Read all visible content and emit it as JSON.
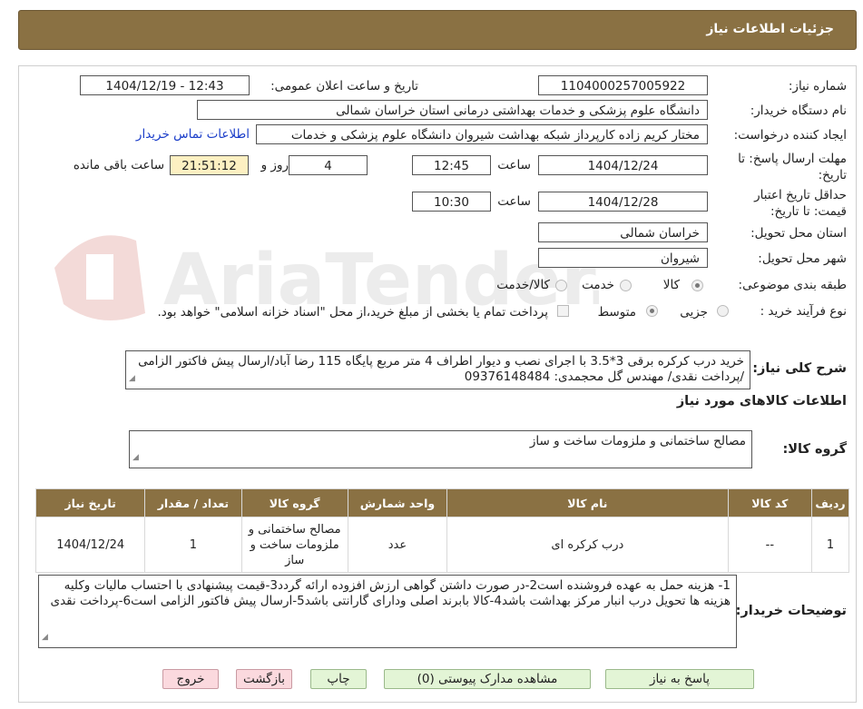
{
  "header": {
    "title": "جزئیات اطلاعات نیاز"
  },
  "watermark": {
    "text": "AriaTender.neT"
  },
  "form": {
    "need_number_label": "شماره نیاز:",
    "need_number": "1104000257005922",
    "announce_label": "تاریخ و ساعت اعلان عمومی:",
    "announce_value": "1404/12/19 - 12:43",
    "buyer_org_label": "نام دستگاه خریدار:",
    "buyer_org": "دانشگاه علوم پزشکی و خدمات بهداشتی درمانی استان خراسان شمالی",
    "creator_label": "ایجاد کننده درخواست:",
    "creator": "مختار کریم زاده کارپرداز شبکه بهداشت شیروان دانشگاه علوم پزشکی و خدمات",
    "contact_link": "اطلاعات تماس خریدار",
    "deadline_label": "مهلت ارسال پاسخ: تا تاریخ:",
    "deadline_date": "1404/12/24",
    "time_label": "ساعت",
    "deadline_time": "12:45",
    "days_value": "4",
    "days_label": "روز و",
    "remaining_time": "21:51:12",
    "remaining_label": "ساعت باقی مانده",
    "validity_label": "حداقل تاریخ اعتبار قیمت: تا تاریخ:",
    "validity_date": "1404/12/28",
    "validity_time": "10:30",
    "province_label": "استان محل تحویل:",
    "province": "خراسان شمالی",
    "city_label": "شهر محل تحویل:",
    "city": "شیروان",
    "category_label": "طبقه بندی موضوعی:",
    "category_options": [
      "کالا",
      "خدمت",
      "کالا/خدمت"
    ],
    "process_label": "نوع فرآیند خرید :",
    "process_options": [
      "جزیی",
      "متوسط"
    ],
    "payment_note": "پرداخت تمام یا بخشی از مبلغ خرید،از محل \"اسناد خزانه اسلامی\" خواهد بود."
  },
  "description": {
    "label": "شرح کلی نیاز:",
    "text": "خرید درب کرکره برقی 3*3.5 با اجرای نصب و دیوار اطراف 4 متر مربع پایگاه 115 رضا آباد/ارسال پیش فاکتور الزامی /پرداخت نقدی/ مهندس گل محجمدی: 09376148484"
  },
  "goods_section": {
    "title": "اطلاعات کالاهای مورد نیاز",
    "group_label": "گروه کالا:",
    "group_value": "مصالح ساختمانی و ملزومات ساخت و ساز"
  },
  "table": {
    "headers": [
      "ردیف",
      "کد کالا",
      "نام کالا",
      "واحد شمارش",
      "گروه کالا",
      "تعداد / مقدار",
      "تاریخ نیاز"
    ],
    "rows": [
      [
        "1",
        "--",
        "درب کرکره ای",
        "عدد",
        "مصالح ساختمانی و ملزومات ساخت و ساز",
        "1",
        "1404/12/24"
      ]
    ]
  },
  "buyer_notes": {
    "label": "توضیحات خریدار:",
    "text": "1- هزینه حمل به عهده فروشنده است2-در صورت داشتن گواهی ارزش افزوده ارائه گردد3-قیمت پیشنهادی با احتساب مالیات وکلیه هزینه ها تحویل درب انبار مرکز بهداشت  باشد4-کالا بابرند اصلی ودارای گارانتی  باشد5-ارسال پیش فاکتور الزامی است6-پرداخت نقدی"
  },
  "buttons": {
    "reply": "پاسخ به نیاز",
    "attachments": "مشاهده مدارک پیوستی (0)",
    "print": "چاپ",
    "back": "بازگشت",
    "exit": "خروج"
  },
  "colors": {
    "header_bg": "#8a7143",
    "timer_bg": "#fdf0c2",
    "link": "#1a3dc9",
    "button_green": "#e3f5d6",
    "button_pink": "#fbd9de"
  }
}
